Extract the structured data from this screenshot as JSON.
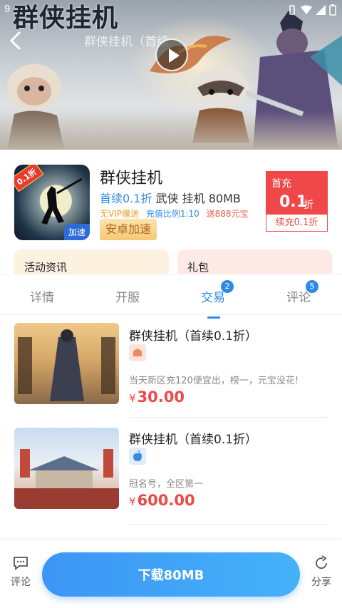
{
  "status_bar": {
    "time": "9"
  },
  "banner": {
    "logo_text": "群侠挂机",
    "title": "群侠挂机（首续",
    "title_suffix": "（",
    "play_icon": "play-icon",
    "back_icon": "arrow-left-icon"
  },
  "game": {
    "name": "群侠挂机",
    "discount_tag": "首续0.1折",
    "category": "武侠 挂机 80MB",
    "promo_vip": "无VIP赠送",
    "promo_ratio": "充值比例1:10",
    "promo_gift": "送888元宝",
    "speed_tag": "安卓加速",
    "icon_badge": "0.1折",
    "icon_speed_label": "加速"
  },
  "discount": {
    "label": "首充",
    "value": "0.1",
    "unit": "折",
    "renew": "续充0.1折"
  },
  "cards": {
    "news": "活动资讯",
    "gift": "礼包"
  },
  "tabs": [
    {
      "label": "详情",
      "badge": ""
    },
    {
      "label": "开服",
      "badge": ""
    },
    {
      "label": "交易",
      "badge": "2"
    },
    {
      "label": "评论",
      "badge": "5"
    }
  ],
  "trades": [
    {
      "title": "群侠挂机（首续0.1折）",
      "platform": "android",
      "desc": "当天新区充120便宜出，榜一，元宝没花!",
      "currency": "¥",
      "price": "30.00"
    },
    {
      "title": "群侠挂机（首续0.1折）",
      "platform": "ios",
      "desc": "冠名号，全区第一",
      "currency": "¥",
      "price": "600.00"
    }
  ],
  "bottom": {
    "comment_label": "评论",
    "download_label": "下载80MB",
    "share_label": "分享"
  },
  "colors": {
    "accent": "#2e8ae6",
    "price_red": "#f04848",
    "download_gradient_start": "#3d95f5",
    "download_gradient_end": "#44b2f9"
  }
}
